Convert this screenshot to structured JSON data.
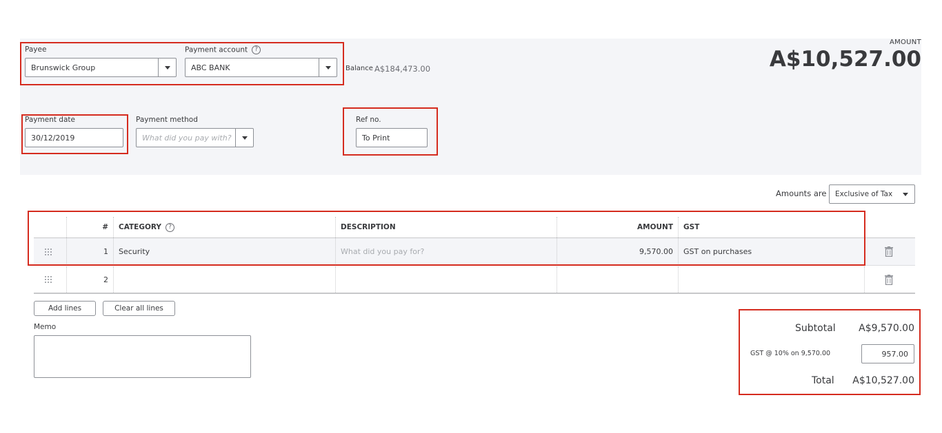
{
  "header": {
    "payee_label": "Payee",
    "payee_value": "Brunswick Group",
    "payment_account_label": "Payment account",
    "payment_account_value": "ABC BANK",
    "balance_label": "Balance",
    "balance_value": "A$184,473.00",
    "amount_label": "AMOUNT",
    "amount_value": "A$10,527.00",
    "payment_date_label": "Payment date",
    "payment_date_value": "30/12/2019",
    "payment_method_label": "Payment method",
    "payment_method_placeholder": "What did you pay with?",
    "ref_label": "Ref no.",
    "ref_value": "To Print",
    "help_glyph": "?"
  },
  "amounts_are": {
    "label": "Amounts are",
    "value": "Exclusive of Tax"
  },
  "table": {
    "columns": {
      "num": "#",
      "category": "CATEGORY",
      "description": "DESCRIPTION",
      "amount": "AMOUNT",
      "gst": "GST"
    },
    "rows": [
      {
        "num": "1",
        "category": "Security",
        "description_placeholder": "What did you pay for?",
        "amount": "9,570.00",
        "gst": "GST on purchases"
      },
      {
        "num": "2",
        "category": "",
        "description_placeholder": "",
        "amount": "",
        "gst": ""
      }
    ]
  },
  "buttons": {
    "add_lines": "Add lines",
    "clear_all_lines": "Clear all lines"
  },
  "memo": {
    "label": "Memo"
  },
  "totals": {
    "subtotal_label": "Subtotal",
    "subtotal_value": "A$9,570.00",
    "gst_label": "GST @ 10% on 9,570.00",
    "gst_value": "957.00",
    "total_label": "Total",
    "total_value": "A$10,527.00"
  },
  "colors": {
    "highlight": "#d52b1e",
    "panel": "#f4f5f8"
  }
}
